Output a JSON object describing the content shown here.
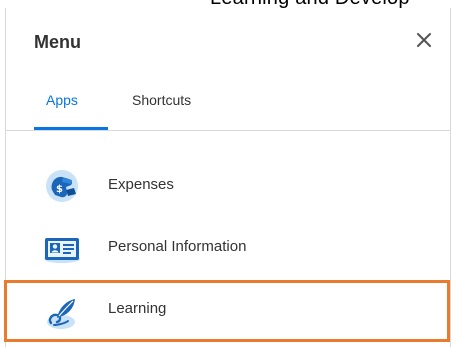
{
  "menu": {
    "title": "Menu",
    "close_icon": "close-icon",
    "tabs": [
      {
        "label": "Apps",
        "active": true
      },
      {
        "label": "Shortcuts",
        "active": false
      }
    ],
    "apps": [
      {
        "label": "Expenses",
        "icon": "expenses-icon"
      },
      {
        "label": "Personal Information",
        "icon": "personal-information-icon"
      },
      {
        "label": "Learning",
        "icon": "learning-icon",
        "highlighted": true
      }
    ]
  },
  "colors": {
    "accent": "#0875e1",
    "highlight": "#e97b2f",
    "text": "#333333",
    "divider": "#d6d8da"
  }
}
